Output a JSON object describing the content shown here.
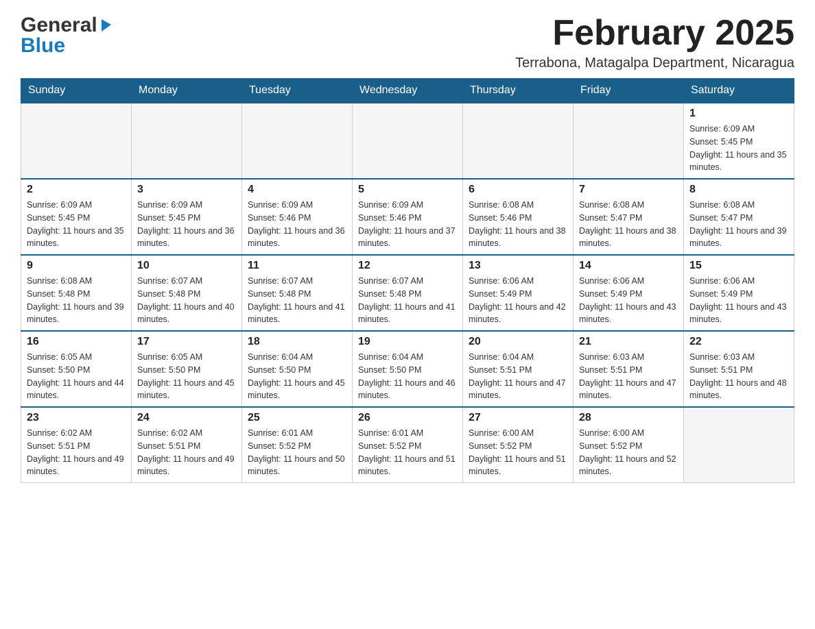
{
  "logo": {
    "general": "General",
    "blue": "Blue"
  },
  "header": {
    "month_year": "February 2025",
    "location": "Terrabona, Matagalpa Department, Nicaragua"
  },
  "weekdays": [
    "Sunday",
    "Monday",
    "Tuesday",
    "Wednesday",
    "Thursday",
    "Friday",
    "Saturday"
  ],
  "weeks": [
    [
      {
        "day": "",
        "empty": true
      },
      {
        "day": "",
        "empty": true
      },
      {
        "day": "",
        "empty": true
      },
      {
        "day": "",
        "empty": true
      },
      {
        "day": "",
        "empty": true
      },
      {
        "day": "",
        "empty": true
      },
      {
        "day": "1",
        "sunrise": "Sunrise: 6:09 AM",
        "sunset": "Sunset: 5:45 PM",
        "daylight": "Daylight: 11 hours and 35 minutes."
      }
    ],
    [
      {
        "day": "2",
        "sunrise": "Sunrise: 6:09 AM",
        "sunset": "Sunset: 5:45 PM",
        "daylight": "Daylight: 11 hours and 35 minutes."
      },
      {
        "day": "3",
        "sunrise": "Sunrise: 6:09 AM",
        "sunset": "Sunset: 5:45 PM",
        "daylight": "Daylight: 11 hours and 36 minutes."
      },
      {
        "day": "4",
        "sunrise": "Sunrise: 6:09 AM",
        "sunset": "Sunset: 5:46 PM",
        "daylight": "Daylight: 11 hours and 36 minutes."
      },
      {
        "day": "5",
        "sunrise": "Sunrise: 6:09 AM",
        "sunset": "Sunset: 5:46 PM",
        "daylight": "Daylight: 11 hours and 37 minutes."
      },
      {
        "day": "6",
        "sunrise": "Sunrise: 6:08 AM",
        "sunset": "Sunset: 5:46 PM",
        "daylight": "Daylight: 11 hours and 38 minutes."
      },
      {
        "day": "7",
        "sunrise": "Sunrise: 6:08 AM",
        "sunset": "Sunset: 5:47 PM",
        "daylight": "Daylight: 11 hours and 38 minutes."
      },
      {
        "day": "8",
        "sunrise": "Sunrise: 6:08 AM",
        "sunset": "Sunset: 5:47 PM",
        "daylight": "Daylight: 11 hours and 39 minutes."
      }
    ],
    [
      {
        "day": "9",
        "sunrise": "Sunrise: 6:08 AM",
        "sunset": "Sunset: 5:48 PM",
        "daylight": "Daylight: 11 hours and 39 minutes."
      },
      {
        "day": "10",
        "sunrise": "Sunrise: 6:07 AM",
        "sunset": "Sunset: 5:48 PM",
        "daylight": "Daylight: 11 hours and 40 minutes."
      },
      {
        "day": "11",
        "sunrise": "Sunrise: 6:07 AM",
        "sunset": "Sunset: 5:48 PM",
        "daylight": "Daylight: 11 hours and 41 minutes."
      },
      {
        "day": "12",
        "sunrise": "Sunrise: 6:07 AM",
        "sunset": "Sunset: 5:48 PM",
        "daylight": "Daylight: 11 hours and 41 minutes."
      },
      {
        "day": "13",
        "sunrise": "Sunrise: 6:06 AM",
        "sunset": "Sunset: 5:49 PM",
        "daylight": "Daylight: 11 hours and 42 minutes."
      },
      {
        "day": "14",
        "sunrise": "Sunrise: 6:06 AM",
        "sunset": "Sunset: 5:49 PM",
        "daylight": "Daylight: 11 hours and 43 minutes."
      },
      {
        "day": "15",
        "sunrise": "Sunrise: 6:06 AM",
        "sunset": "Sunset: 5:49 PM",
        "daylight": "Daylight: 11 hours and 43 minutes."
      }
    ],
    [
      {
        "day": "16",
        "sunrise": "Sunrise: 6:05 AM",
        "sunset": "Sunset: 5:50 PM",
        "daylight": "Daylight: 11 hours and 44 minutes."
      },
      {
        "day": "17",
        "sunrise": "Sunrise: 6:05 AM",
        "sunset": "Sunset: 5:50 PM",
        "daylight": "Daylight: 11 hours and 45 minutes."
      },
      {
        "day": "18",
        "sunrise": "Sunrise: 6:04 AM",
        "sunset": "Sunset: 5:50 PM",
        "daylight": "Daylight: 11 hours and 45 minutes."
      },
      {
        "day": "19",
        "sunrise": "Sunrise: 6:04 AM",
        "sunset": "Sunset: 5:50 PM",
        "daylight": "Daylight: 11 hours and 46 minutes."
      },
      {
        "day": "20",
        "sunrise": "Sunrise: 6:04 AM",
        "sunset": "Sunset: 5:51 PM",
        "daylight": "Daylight: 11 hours and 47 minutes."
      },
      {
        "day": "21",
        "sunrise": "Sunrise: 6:03 AM",
        "sunset": "Sunset: 5:51 PM",
        "daylight": "Daylight: 11 hours and 47 minutes."
      },
      {
        "day": "22",
        "sunrise": "Sunrise: 6:03 AM",
        "sunset": "Sunset: 5:51 PM",
        "daylight": "Daylight: 11 hours and 48 minutes."
      }
    ],
    [
      {
        "day": "23",
        "sunrise": "Sunrise: 6:02 AM",
        "sunset": "Sunset: 5:51 PM",
        "daylight": "Daylight: 11 hours and 49 minutes."
      },
      {
        "day": "24",
        "sunrise": "Sunrise: 6:02 AM",
        "sunset": "Sunset: 5:51 PM",
        "daylight": "Daylight: 11 hours and 49 minutes."
      },
      {
        "day": "25",
        "sunrise": "Sunrise: 6:01 AM",
        "sunset": "Sunset: 5:52 PM",
        "daylight": "Daylight: 11 hours and 50 minutes."
      },
      {
        "day": "26",
        "sunrise": "Sunrise: 6:01 AM",
        "sunset": "Sunset: 5:52 PM",
        "daylight": "Daylight: 11 hours and 51 minutes."
      },
      {
        "day": "27",
        "sunrise": "Sunrise: 6:00 AM",
        "sunset": "Sunset: 5:52 PM",
        "daylight": "Daylight: 11 hours and 51 minutes."
      },
      {
        "day": "28",
        "sunrise": "Sunrise: 6:00 AM",
        "sunset": "Sunset: 5:52 PM",
        "daylight": "Daylight: 11 hours and 52 minutes."
      },
      {
        "day": "",
        "empty": true
      }
    ]
  ]
}
